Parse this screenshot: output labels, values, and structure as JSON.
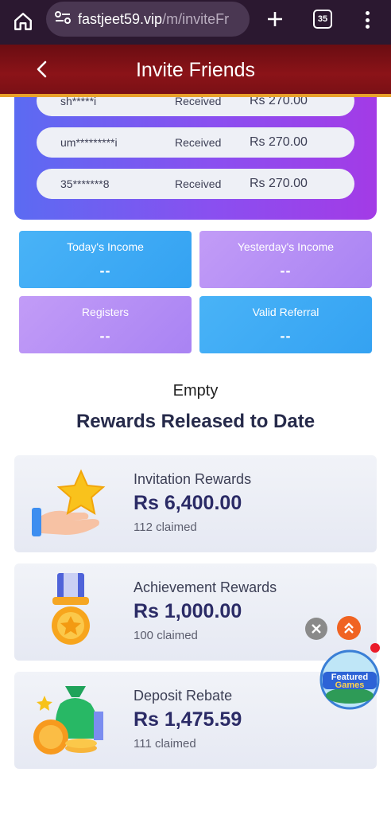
{
  "browser": {
    "url_host": "fastjeet59.vip",
    "url_path": "/m/inviteFr",
    "tab_count": "35"
  },
  "header": {
    "title": "Invite Friends"
  },
  "claims": [
    {
      "user": "sh*****i",
      "status": "Received",
      "amount": "Rs 270.00"
    },
    {
      "user": "um*********i",
      "status": "Received",
      "amount": "Rs 270.00"
    },
    {
      "user": "35*******8",
      "status": "Received",
      "amount": "Rs 270.00"
    }
  ],
  "stats": {
    "todays_income": {
      "label": "Today's Income",
      "value": "--"
    },
    "yesterdays_income": {
      "label": "Yesterday's Income",
      "value": "--"
    },
    "registers": {
      "label": "Registers",
      "value": "--"
    },
    "valid_referral": {
      "label": "Valid Referral",
      "value": "--"
    }
  },
  "empty_text": "Empty",
  "rewards_section": {
    "title": "Rewards Released to Date",
    "items": [
      {
        "name": "Invitation Rewards",
        "amount": "Rs 6,400.00",
        "claimed": "112 claimed",
        "icon": "star-hand-icon"
      },
      {
        "name": "Achievement Rewards",
        "amount": "Rs 1,000.00",
        "claimed": "100 claimed",
        "icon": "medal-icon"
      },
      {
        "name": "Deposit Rebate",
        "amount": "Rs 1,475.59",
        "claimed": "111 claimed",
        "icon": "money-bag-icon"
      }
    ]
  },
  "featured_badge": {
    "line1": "Featured",
    "line2": "Games"
  },
  "colors": {
    "header_bg": "#8b1318",
    "header_accent": "#e8a12a",
    "panel_gradient_start": "#5b6bf2",
    "panel_gradient_end": "#a33be6",
    "blue_card": "#3aa6f3",
    "violet_card": "#b38df5",
    "amount_text": "#2b2b66"
  }
}
